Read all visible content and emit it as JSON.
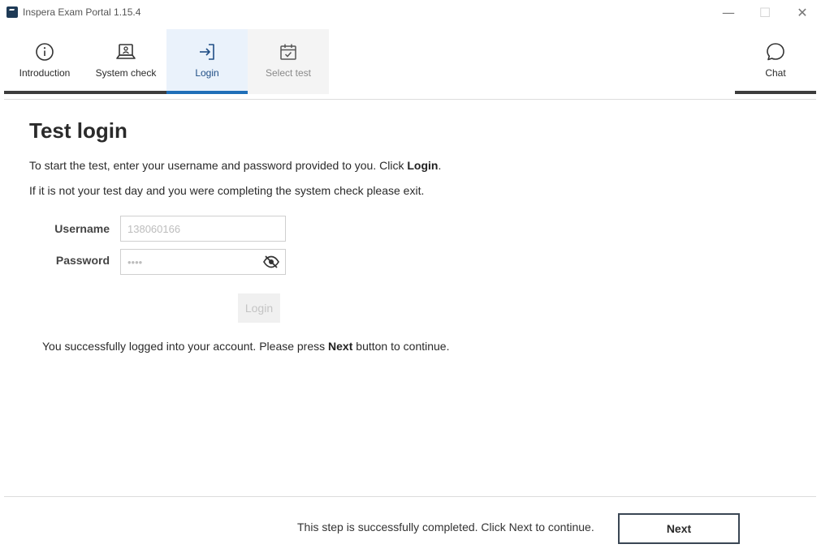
{
  "window": {
    "title": "Inspera Exam Portal 1.15.4",
    "minimize_glyph": "—",
    "maximize_glyph": "☐",
    "close_glyph": "✕"
  },
  "nav": {
    "tabs": [
      {
        "label": "Introduction",
        "icon": "info-icon",
        "state": "completed"
      },
      {
        "label": "System check",
        "icon": "laptop-icon",
        "state": "completed"
      },
      {
        "label": "Login",
        "icon": "login-arrow-icon",
        "state": "active"
      },
      {
        "label": "Select test",
        "icon": "calendar-check-icon",
        "state": "disabled"
      }
    ],
    "chat": {
      "label": "Chat",
      "icon": "chat-bubble-icon"
    }
  },
  "main": {
    "title": "Test login",
    "intro_line1_prefix": "To start the test, enter your username and password provided to you. Click ",
    "intro_line1_bold": "Login",
    "intro_line1_suffix": ".",
    "intro_line2": "If it is not your test day and you were completing the system check please exit.",
    "form": {
      "username_label": "Username",
      "username_value": "138060166",
      "password_label": "Password",
      "password_value": "••••",
      "login_button": "Login"
    },
    "success_prefix": "You successfully logged into your account. Please press ",
    "success_bold": "Next",
    "success_suffix": " button to continue."
  },
  "footer": {
    "status_text": "This step is successfully completed. Click Next to continue.",
    "next_button": "Next"
  },
  "colors": {
    "active_accent": "#1f6fb8",
    "completed_underline": "#3d3d3d",
    "active_tab_bg": "#eaf2fb",
    "disabled_tab_bg": "#f4f4f4"
  }
}
